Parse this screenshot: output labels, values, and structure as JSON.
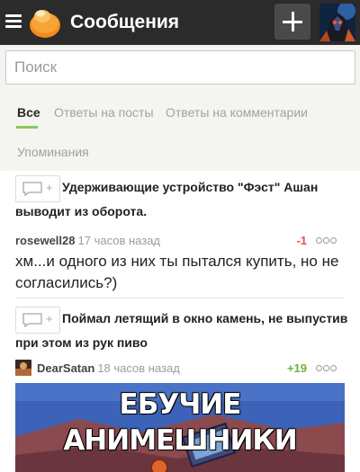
{
  "header": {
    "title": "Сообщения",
    "icons": {
      "menu": "hamburger-icon",
      "logo": "pikabu-logo",
      "add": "plus-icon",
      "avatar": "user-avatar"
    }
  },
  "search": {
    "placeholder": "Поиск",
    "value": ""
  },
  "tabs": [
    {
      "label": "Все",
      "active": true
    },
    {
      "label": "Ответы на посты",
      "active": false
    },
    {
      "label": "Ответы на комментарии",
      "active": false
    },
    {
      "label": "Упоминания",
      "active": false
    }
  ],
  "colors": {
    "header_bg": "#2b2b2b",
    "accent": "#8ac858",
    "negative": "#e0534a",
    "positive": "#6cb33e"
  },
  "comments": [
    {
      "post_title": "Удерживающие устройство \"Фэст\" Ашан выводит из оборота.",
      "author": "rosewell28",
      "time": "17 часов назад",
      "rating": "-1",
      "text": "хм...и одного из них ты пытался купить, но не согласились?)"
    },
    {
      "post_title": "Поймал летящий в окно камень, не выпустив при этом из рук пиво",
      "author": "DearSatan",
      "time": "18 часов назад",
      "rating": "+19",
      "image_caption": "ЕБУЧИЕ АНИМЕШНИКИ"
    }
  ]
}
